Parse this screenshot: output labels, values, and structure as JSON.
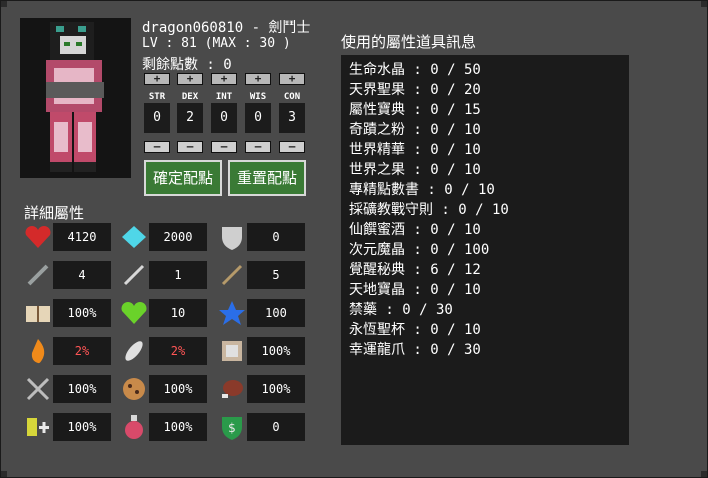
{
  "player": {
    "name_line": "dragon060810 - 劍鬥士",
    "level_line": "LV : 81 (MAX : 30 )",
    "points_line": "剩餘點數 :  0"
  },
  "stats": [
    {
      "label": "STR",
      "value": "0"
    },
    {
      "label": "DEX",
      "value": "2"
    },
    {
      "label": "INT",
      "value": "0"
    },
    {
      "label": "WIS",
      "value": "0"
    },
    {
      "label": "CON",
      "value": "3"
    }
  ],
  "buttons": {
    "confirm": "確定配點",
    "reset": "重置配點",
    "plus": "+",
    "minus": "—"
  },
  "detail": {
    "title": "詳細屬性",
    "rows": [
      [
        {
          "icon": "heart-icon",
          "value": "4120",
          "color": "#ffffff"
        },
        {
          "icon": "diamond-icon",
          "value": "2000",
          "color": "#ffffff"
        },
        {
          "icon": "shield-icon",
          "value": "0",
          "color": "#ffffff"
        }
      ],
      [
        {
          "icon": "sword-icon",
          "value": "4",
          "color": "#ffffff"
        },
        {
          "icon": "wand-icon",
          "value": "1",
          "color": "#ffffff"
        },
        {
          "icon": "arrow-icon",
          "value": "5",
          "color": "#ffffff"
        }
      ],
      [
        {
          "icon": "book-icon",
          "value": "100%",
          "color": "#ffffff"
        },
        {
          "icon": "green-heart-icon",
          "value": "10",
          "color": "#ffffff"
        },
        {
          "icon": "star-icon",
          "value": "100",
          "color": "#ffffff"
        }
      ],
      [
        {
          "icon": "fire-icon",
          "value": "2%",
          "color": "#ff5555"
        },
        {
          "icon": "feather-icon",
          "value": "2%",
          "color": "#ff5555"
        },
        {
          "icon": "scroll-frame-icon",
          "value": "100%",
          "color": "#ffffff"
        }
      ],
      [
        {
          "icon": "crossed-swords-icon",
          "value": "100%",
          "color": "#ffffff"
        },
        {
          "icon": "cookie-icon",
          "value": "100%",
          "color": "#ffffff"
        },
        {
          "icon": "meat-icon",
          "value": "100%",
          "color": "#ffffff"
        }
      ],
      [
        {
          "icon": "xp-plus-icon",
          "value": "100%",
          "color": "#ffffff"
        },
        {
          "icon": "potion-icon",
          "value": "100%",
          "color": "#ffffff"
        },
        {
          "icon": "dollar-shield-icon",
          "value": "0",
          "color": "#ffffff"
        }
      ]
    ]
  },
  "items": {
    "title": "使用的屬性道具訊息",
    "list": [
      "生命水晶 : 0 / 50",
      "天界聖果 : 0 / 20",
      "屬性寶典 : 0 / 15",
      "奇蹟之粉 : 0 / 10",
      "世界精華 : 0 / 10",
      "世界之果 : 0 / 10",
      "專精點數書 : 0 / 10",
      "採礦教戰守則 : 0 / 10",
      "仙饌蜜酒 : 0 / 10",
      "次元魔晶 : 0 / 100",
      "覺醒秘典 : 6 / 12",
      "天地寶晶 : 0 / 10",
      "禁藥 : 0 / 30",
      "永恆聖杯 : 0 / 10",
      "幸運龍爪 : 0 / 30"
    ]
  }
}
